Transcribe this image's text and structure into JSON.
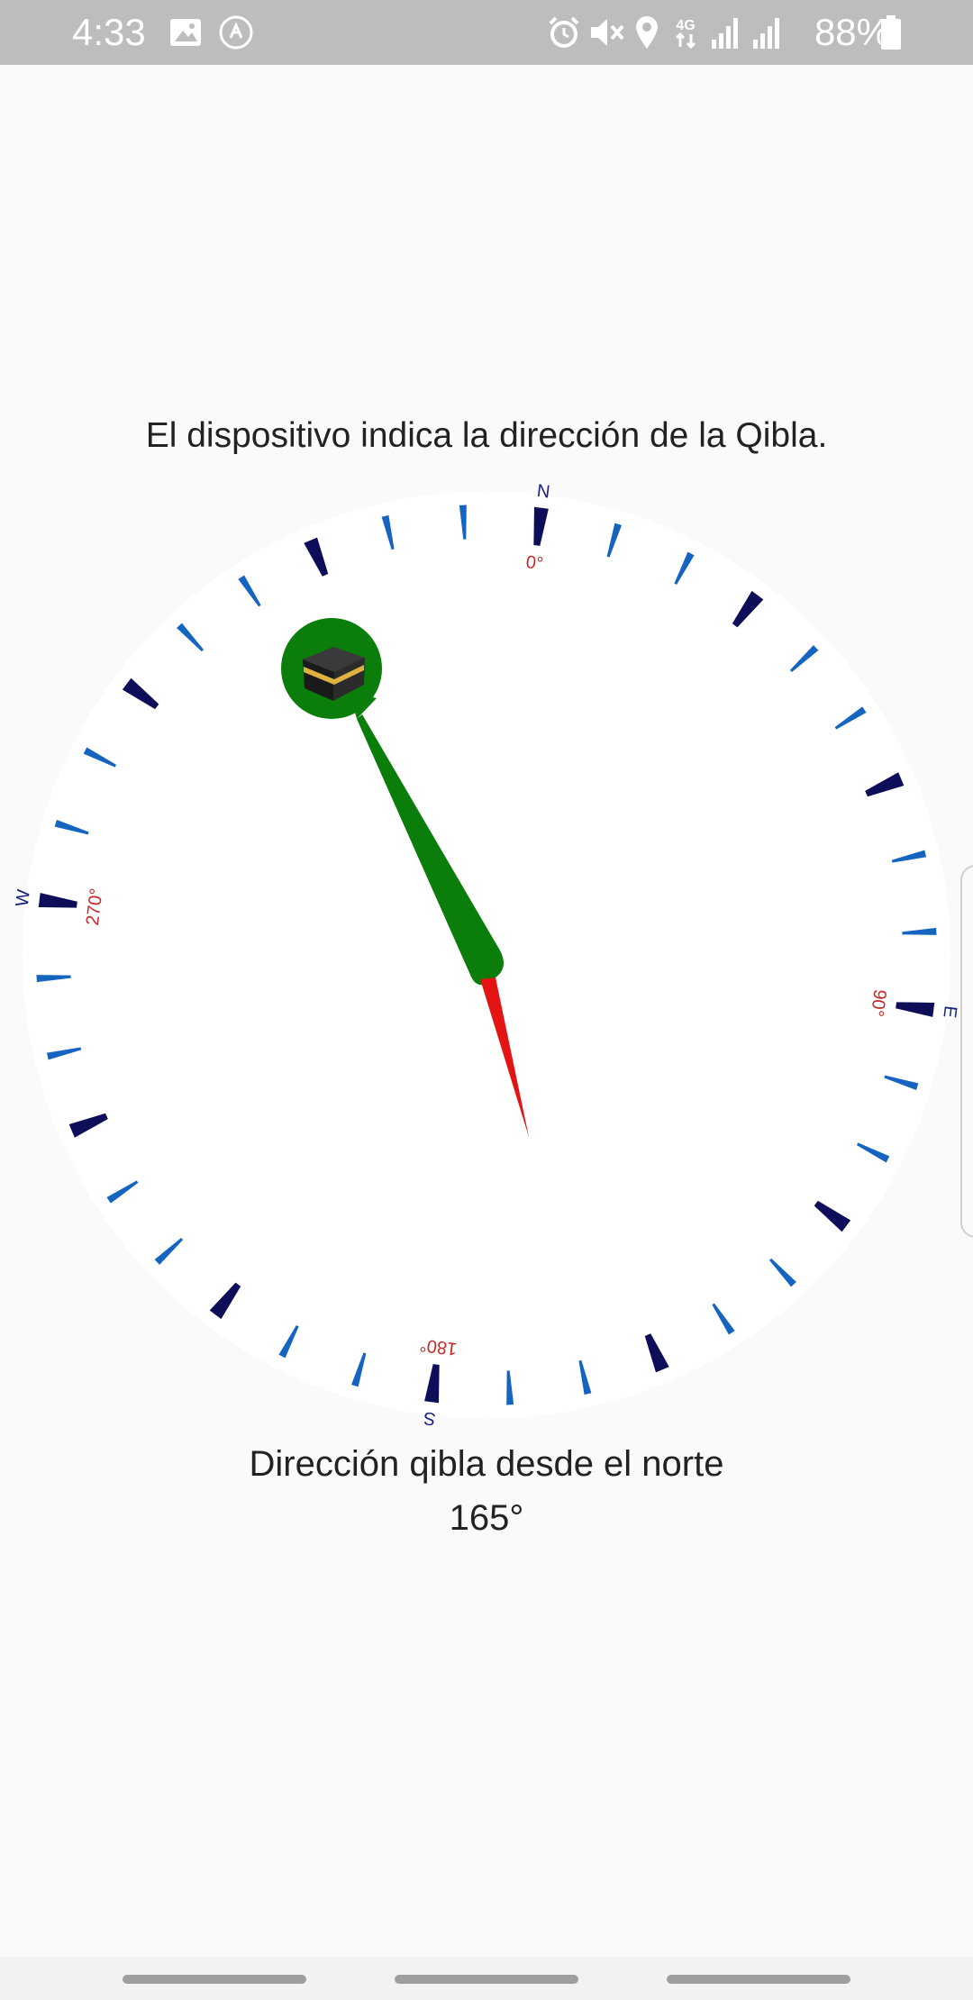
{
  "status_bar": {
    "time": "4:33",
    "battery_percent": "88%",
    "icons": [
      "image-icon",
      "accessibility-icon",
      "alarm-icon",
      "mute-icon",
      "location-icon",
      "4g-icon",
      "signal-icon",
      "signal-icon-2",
      "battery-icon"
    ]
  },
  "main": {
    "instruction": "El dispositivo indica la dirección de la Qibla.",
    "direction_label": "Dirección qibla desde el norte",
    "direction_value": "165°"
  },
  "compass": {
    "rotation_deg": 187,
    "qibla_bearing_deg": 165,
    "cardinals": [
      {
        "letter": "N",
        "deg": 0
      },
      {
        "letter": "E",
        "deg": 90
      },
      {
        "letter": "S",
        "deg": 180
      },
      {
        "letter": "W",
        "deg": 270
      }
    ],
    "degree_labels": [
      {
        "text": "0°",
        "deg": 0
      },
      {
        "text": "90°",
        "deg": 90
      },
      {
        "text": "180°",
        "deg": 180
      },
      {
        "text": "270°",
        "deg": 270
      }
    ],
    "colors": {
      "major_tick": "#0d0d5a",
      "minor_tick": "#1565c0",
      "cardinal_text": "#1a237e",
      "degree_text": "#c62828",
      "qibla_needle": "#0a7d0a",
      "north_needle": "#e51414"
    },
    "kaaba_icon": "kaaba-icon"
  },
  "nav_bar": {
    "items": [
      "nav-pill-left",
      "nav-pill-center",
      "nav-pill-right"
    ]
  }
}
